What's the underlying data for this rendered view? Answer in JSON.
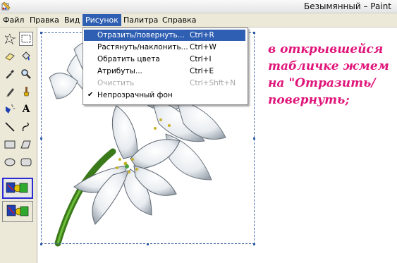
{
  "window": {
    "title": "Безымянный – Paint"
  },
  "menubar": {
    "items": [
      {
        "label": "Файл"
      },
      {
        "label": "Правка"
      },
      {
        "label": "Вид"
      },
      {
        "label": "Рисунок"
      },
      {
        "label": "Палитра"
      },
      {
        "label": "Справка"
      }
    ],
    "active": "Рисунок"
  },
  "image_menu": {
    "items": [
      {
        "label": "Отразить/повернуть...",
        "shortcut": "Ctrl+R",
        "state": "highlighted"
      },
      {
        "label": "Растянуть/наклонить...",
        "shortcut": "Ctrl+W",
        "state": "normal"
      },
      {
        "label": "Обратить цвета",
        "shortcut": "Ctrl+I",
        "state": "normal"
      },
      {
        "label": "Атрибуты...",
        "shortcut": "Ctrl+E",
        "state": "normal"
      },
      {
        "label": "Очистить",
        "shortcut": "Ctrl+Shft+N",
        "state": "disabled"
      },
      {
        "label": "Непрозрачный фон",
        "shortcut": "",
        "state": "checked"
      }
    ],
    "check_mark": "✔"
  },
  "toolbox": {
    "tools": [
      "free-select-icon",
      "rect-select-icon",
      "eraser-icon",
      "fill-icon",
      "color-picker-icon",
      "magnifier-icon",
      "pencil-icon",
      "brush-icon",
      "airbrush-icon",
      "text-icon",
      "line-icon",
      "curve-icon",
      "rectangle-icon",
      "polygon-icon",
      "ellipse-icon",
      "rounded-rect-icon"
    ],
    "text_tool_glyph": "A",
    "options": [
      "opaque-background-option",
      "transparent-background-option"
    ]
  },
  "annotation": {
    "text": "в открывшейся\nтабличке жмем\nна \"Отразить/\nповернуть;"
  },
  "colors": {
    "menu_highlight": "#2f5fb3",
    "annotation": "#e0157a",
    "toolbar_bg": "#ece9d8"
  }
}
